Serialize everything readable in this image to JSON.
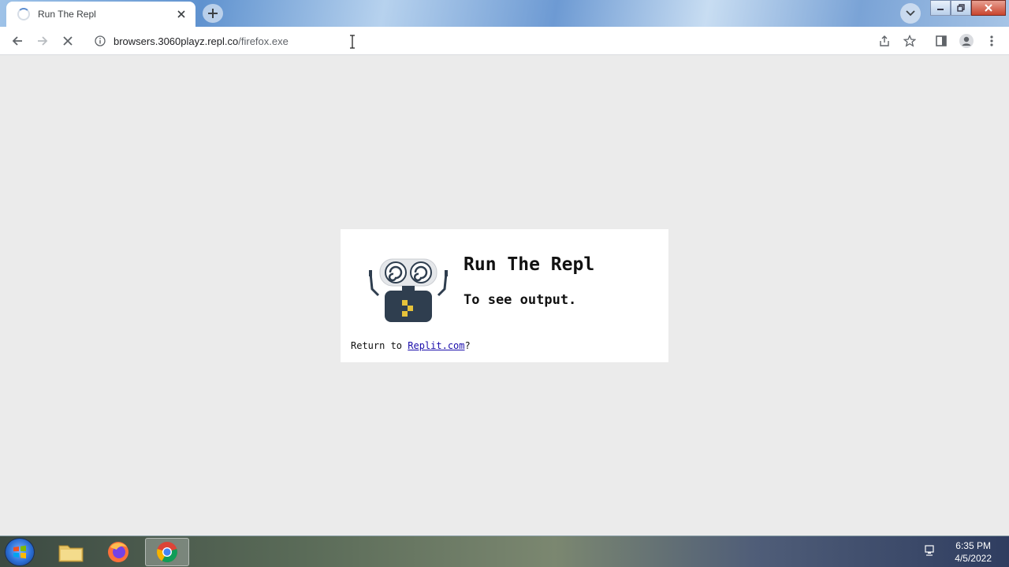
{
  "browser": {
    "tab_title": "Run The Repl",
    "url_host": "browsers.3060playz.repl.co",
    "url_path": "/firefox.exe"
  },
  "page": {
    "title": "Run The Repl",
    "subtitle": "To see output.",
    "return_prefix": "Return to ",
    "return_link": "Replit.com",
    "return_suffix": "?"
  },
  "taskbar": {
    "apps": [
      "file-explorer",
      "firefox",
      "chrome"
    ],
    "time": "6:35 PM",
    "date": "4/5/2022"
  },
  "colors": {
    "link": "#1a0dab",
    "robot_body": "#2f3e4f",
    "robot_accent": "#e6c23a",
    "page_bg": "#ebebeb"
  }
}
